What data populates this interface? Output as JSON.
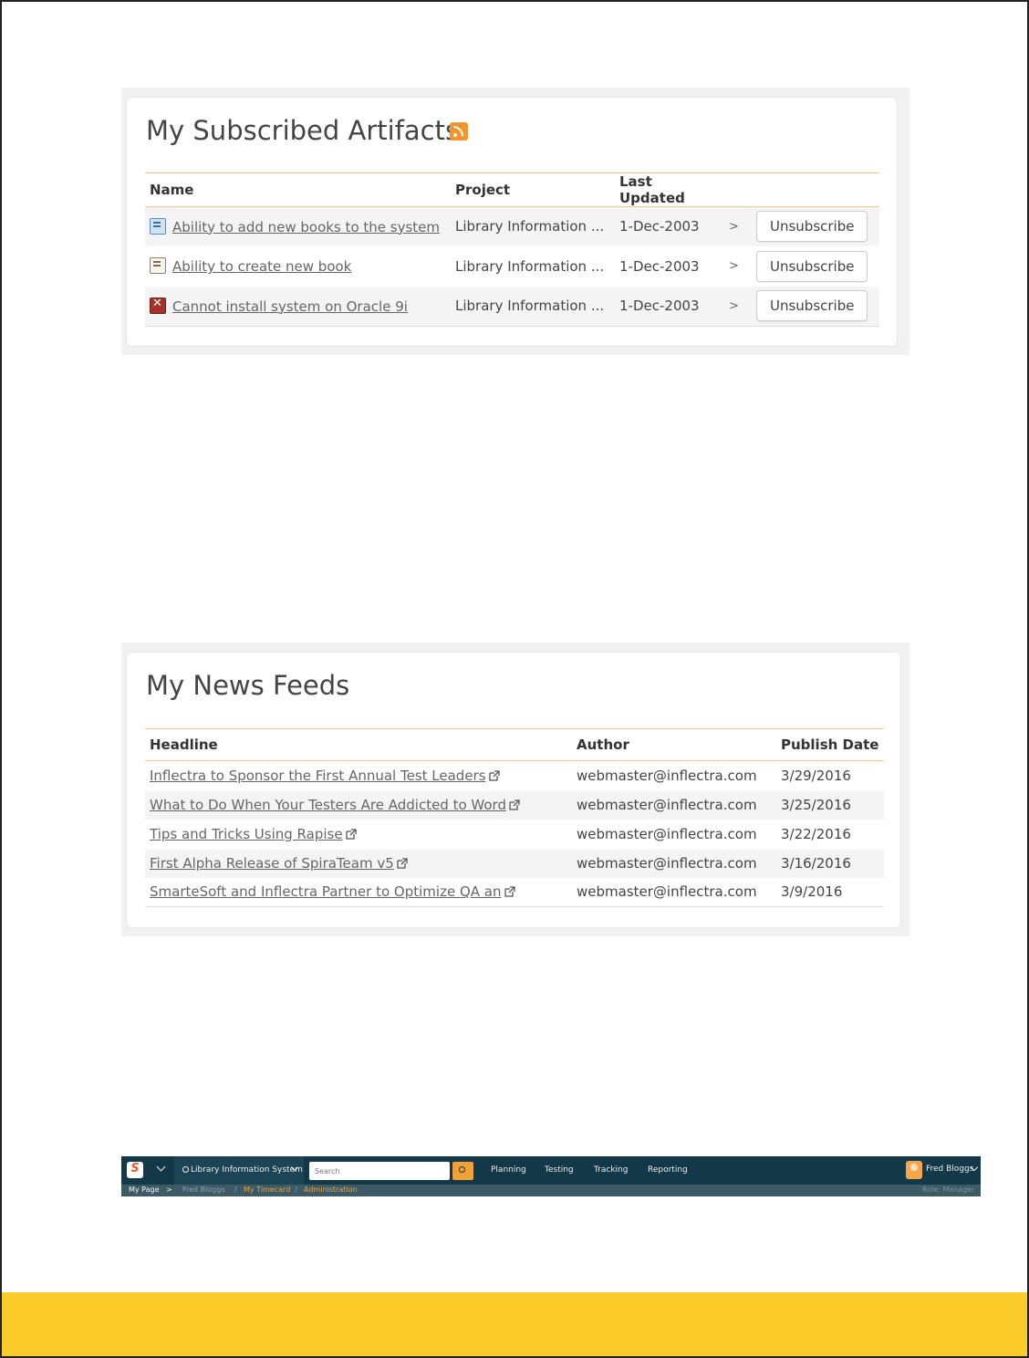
{
  "subscribed": {
    "title": "My Subscribed Artifacts",
    "rss_icon": "rss-feed-icon",
    "columns": [
      "Name",
      "Project",
      "Last Updated"
    ],
    "rows": [
      {
        "icon": "requirement-icon",
        "name": "Ability to add new books to the system",
        "project": "Library Information ...",
        "updated": "1-Dec-2003",
        "arrow": ">",
        "action": "Unsubscribe"
      },
      {
        "icon": "requirement-icon",
        "name": "Ability to create new book",
        "project": "Library Information ...",
        "updated": "1-Dec-2003",
        "arrow": ">",
        "action": "Unsubscribe"
      },
      {
        "icon": "incident-icon",
        "name": "Cannot install system on Oracle 9i",
        "project": "Library Information ...",
        "updated": "1-Dec-2003",
        "arrow": ">",
        "action": "Unsubscribe"
      }
    ]
  },
  "news": {
    "title": "My News Feeds",
    "columns": [
      "Headline",
      "Author",
      "Publish Date"
    ],
    "rows": [
      {
        "headline": "Inflectra to Sponsor the First Annual Test Leaders",
        "author": "webmaster@inflectra.com",
        "date": "3/29/2016"
      },
      {
        "headline": "What to Do When Your Testers Are Addicted to Word",
        "author": "webmaster@inflectra.com",
        "date": "3/25/2016"
      },
      {
        "headline": "Tips and Tricks Using Rapise",
        "author": "webmaster@inflectra.com",
        "date": "3/22/2016"
      },
      {
        "headline": "First Alpha Release of SpiraTeam v5",
        "author": "webmaster@inflectra.com",
        "date": "3/16/2016"
      },
      {
        "headline": "SmarteSoft and Inflectra Partner to Optimize QA an",
        "author": "webmaster@inflectra.com",
        "date": "3/9/2016"
      }
    ]
  },
  "navbar": {
    "logo_letter": "S",
    "project": "Library Information System",
    "search_placeholder": "Search",
    "menus": [
      "Planning",
      "Testing",
      "Tracking",
      "Reporting"
    ],
    "user": "Fred Bloggs",
    "breadcrumb": [
      "My Page",
      "Fred Bloggs",
      "My Timecard",
      "Administration"
    ],
    "role": "Role: Manager"
  },
  "colors": {
    "accent": "#f0962c",
    "navbar_bg": "#133847",
    "footer": "#fbcc2a",
    "header_rule": "#f3c98b"
  }
}
